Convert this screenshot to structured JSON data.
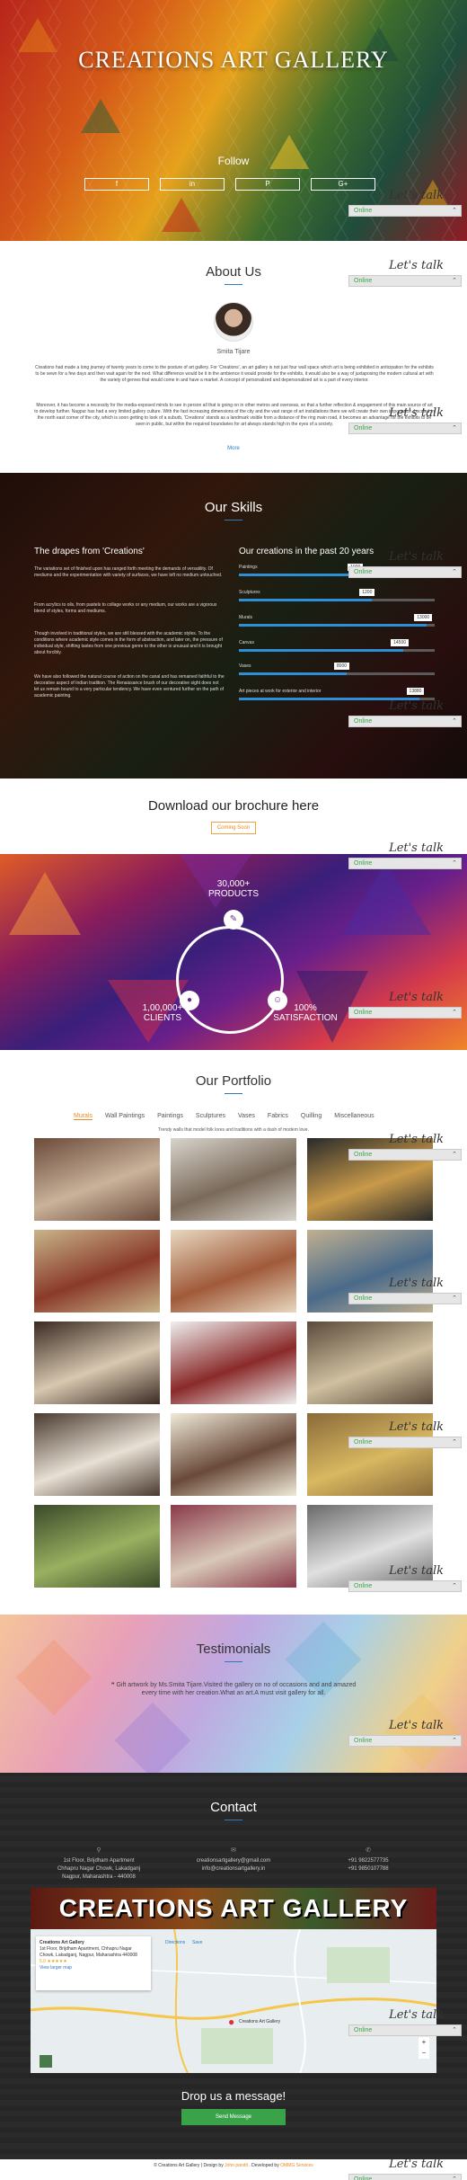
{
  "hero": {
    "title": "CREATIONS ART GALLERY",
    "follow_label": "Follow",
    "social": [
      {
        "icon": "facebook-icon",
        "glyph": "f"
      },
      {
        "icon": "linkedin-icon",
        "glyph": "in"
      },
      {
        "icon": "pinterest-icon",
        "glyph": "P"
      },
      {
        "icon": "google-plus-icon",
        "glyph": "G+"
      }
    ]
  },
  "chat_widget": {
    "script_label": "Let's talk",
    "status": "Online"
  },
  "about": {
    "heading": "About Us",
    "name": "Smita Tijare",
    "para1": "Creations had made a long journey of twenty years to come to the posture of art gallery. For 'Creations', an art gallery is not just four wall space which art is being exhibited in anticipation for the exhibits to be sewn for a few days and then wait again for the next. What difference would be it in the ambience it would provide for the exhibits, it would also be a way of juxtaposing the modern cultural art with the variety of genres that would come in and have a market. A concept of personalized and depersonalized art is a part of every interior.",
    "para2": "Moreover, it has become a necessity for the media-exposed minds to see in person all that is going on in other metros and overseas, so that a further reflection & engagement of this main source of art to develop further. Nagpur has had a very limited gallery culture. With the fast increasing dimensions of the city and the vast range of art installations there we will create their own importance. Located in the north east corner of the city, which is soon getting to look of a suburb, 'Creations' stands as a landmark visible from a distance of the ring main road, it becomes an advantage for the exhibits to be seen in public, but within the required boundaries for art always stands high in the eyes of a society.",
    "more_label": "More"
  },
  "skills": {
    "heading": "Our Skills",
    "left_heading": "The drapes from 'Creations'",
    "right_heading": "Our creations in the past 20 years",
    "paras": [
      "The variations set of finished upon has ranged forth meeting the demands of versatility. Of mediums and the experimentation with variety of surfaces, we have left no medium untouched.",
      "From acrylics to oils, from pastels to collage works or any medium, our works are a vigorous blend of styles, forms and mediums.",
      "Though involved in traditional styles, we are still blessed with the academic styles. To the conditions where academic style comes in the form of abstraction, and later on, the pressure of individual style, shifting tastes from one previous genre to the other is unusual and it is brought about forcibly.",
      "We have also followed the natural course of action on the canal and has remained faithful to the decorative aspect of Indian tradition. The Renaissance brush of our decorative sight does not let us remain bound to a very particular tendency. We have even ventured further on the path of academic painting."
    ],
    "bars": [
      {
        "label": "Paintings",
        "value": "1000",
        "pct": 0.62
      },
      {
        "label": "Sculptures",
        "value": "1200",
        "pct": 0.68
      },
      {
        "label": "Murals",
        "value": "13000",
        "pct": 0.96
      },
      {
        "label": "Canvas",
        "value": "14500",
        "pct": 0.84
      },
      {
        "label": "Vases",
        "value": "8000",
        "pct": 0.55
      },
      {
        "label": "Art pieces at work for exterior and interior",
        "value": "13880",
        "pct": 0.92
      }
    ]
  },
  "brochure": {
    "heading": "Download our brochure here",
    "button": "Coming Soon"
  },
  "stats": [
    {
      "value": "30,000+",
      "label": "PRODUCTS",
      "icon": "paint-brush-icon",
      "glyph": "✎"
    },
    {
      "value": "1,00,000+",
      "label": "CLIENTS",
      "icon": "user-icon",
      "glyph": "●"
    },
    {
      "value": "100%",
      "label": "SATISFACTION",
      "icon": "smile-icon",
      "glyph": "☺"
    }
  ],
  "portfolio": {
    "heading": "Our Portfolio",
    "tabs": [
      "Murals",
      "Wall Paintings",
      "Paintings",
      "Sculptures",
      "Vases",
      "Fabrics",
      "Quilling",
      "Miscellaneous"
    ],
    "active_tab": "Murals",
    "subtitle": "Trendy walls that model folk lores and traditions with a dash of modern love.",
    "images": 15
  },
  "testimonials": {
    "heading": "Testimonials",
    "quote": "Gift artwork by Ms.Smita Tijare.Visited the gallery on no of occasions and and amazed every time with her creation.What an art.A must visit gallery for all."
  },
  "contact": {
    "heading": "Contact",
    "address": [
      "1st Floor, Brijdham Apartment",
      "Chhapru Nagar Chowk, Lakadganj",
      "Nagpur, Maharashtra - 440008"
    ],
    "emails": [
      "creationsartgallery@gmail.com",
      "info@creationsartgallery.in"
    ],
    "phones": [
      "+91 9822577735",
      "+91 9850107788"
    ],
    "banner_text": "CREATIONS ART GALLERY",
    "map_card": {
      "title": "Creations Art Gallery",
      "address": "1st Floor, Brijdham Apartment, Chhapru Nagar Chowk, Lakadganj, Nagpur, Maharashtra 440008",
      "rating": "5.0 ★★★★★",
      "reviews": "1 review",
      "larger": "View larger map",
      "directions": "Directions",
      "save": "Save",
      "pin": "Creations Art Gallery"
    },
    "drop_label": "Drop us a message!",
    "send_button": "Send Message"
  },
  "footer": {
    "text1": "© Creations Art Gallery | Design by ",
    "designer": "John pandit",
    "text2": " . Developed by ",
    "developer": "OMMG Services"
  }
}
